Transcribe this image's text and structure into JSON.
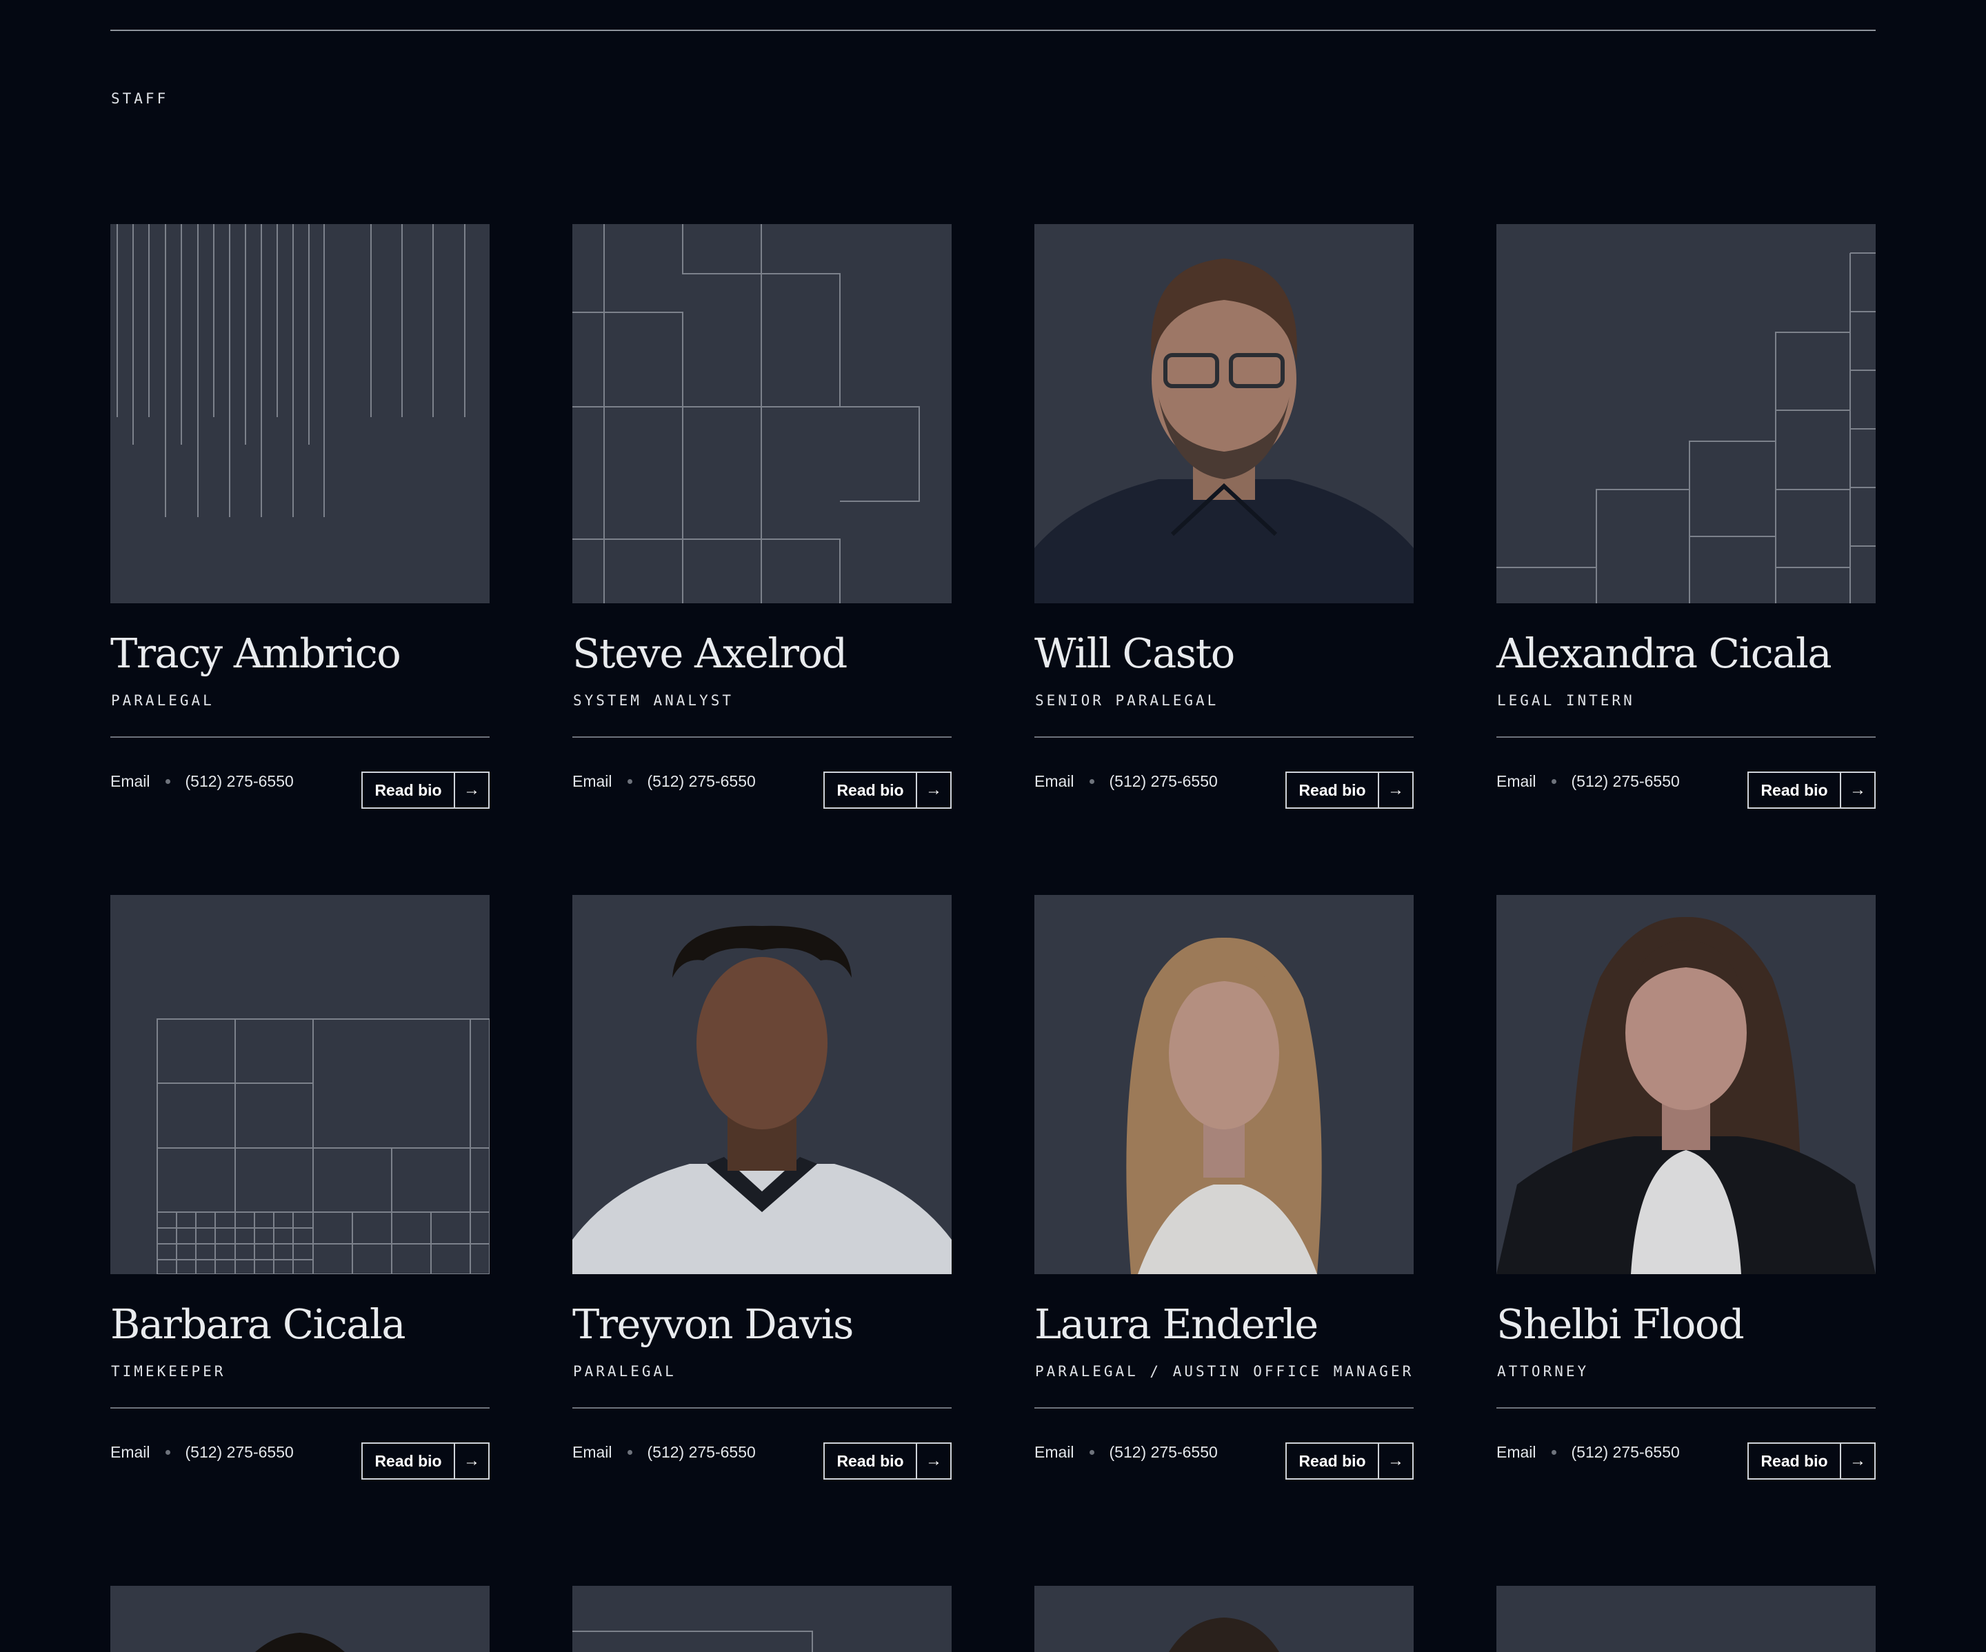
{
  "section": {
    "label": "STAFF"
  },
  "staff": [
    {
      "name": "Tracy Ambrico",
      "role": "PARALEGAL",
      "email_label": "Email",
      "phone": "(512) 275-6550",
      "bio_label": "Read bio",
      "photo": "pattern-vertical-lines"
    },
    {
      "name": "Steve Axelrod",
      "role": "SYSTEM ANALYST",
      "email_label": "Email",
      "phone": "(512) 275-6550",
      "bio_label": "Read bio",
      "photo": "pattern-blocks"
    },
    {
      "name": "Will Casto",
      "role": "SENIOR PARALEGAL",
      "email_label": "Email",
      "phone": "(512) 275-6550",
      "bio_label": "Read bio",
      "photo": "portrait-man-glasses-beard"
    },
    {
      "name": "Alexandra Cicala",
      "role": "LEGAL INTERN",
      "email_label": "Email",
      "phone": "(512) 275-6550",
      "bio_label": "Read bio",
      "photo": "pattern-steps"
    },
    {
      "name": "Barbara Cicala",
      "role": "TIMEKEEPER",
      "email_label": "Email",
      "phone": "(512) 275-6550",
      "bio_label": "Read bio",
      "photo": "pattern-grid"
    },
    {
      "name": "Treyvon Davis",
      "role": "PARALEGAL",
      "email_label": "Email",
      "phone": "(512) 275-6550",
      "bio_label": "Read bio",
      "photo": "portrait-young-man"
    },
    {
      "name": "Laura Enderle",
      "role": "PARALEGAL / AUSTIN OFFICE MANAGER",
      "email_label": "Email",
      "phone": "(512) 275-6550",
      "bio_label": "Read bio",
      "photo": "portrait-woman-blonde"
    },
    {
      "name": "Shelbi Flood",
      "role": "ATTORNEY",
      "email_label": "Email",
      "phone": "(512) 275-6550",
      "bio_label": "Read bio",
      "photo": "portrait-woman-brunette"
    }
  ],
  "colors": {
    "background": "#040812",
    "photo_bg": "#323743",
    "line": "#8e939b"
  },
  "icons": {
    "arrow": "arrow-right-icon"
  }
}
